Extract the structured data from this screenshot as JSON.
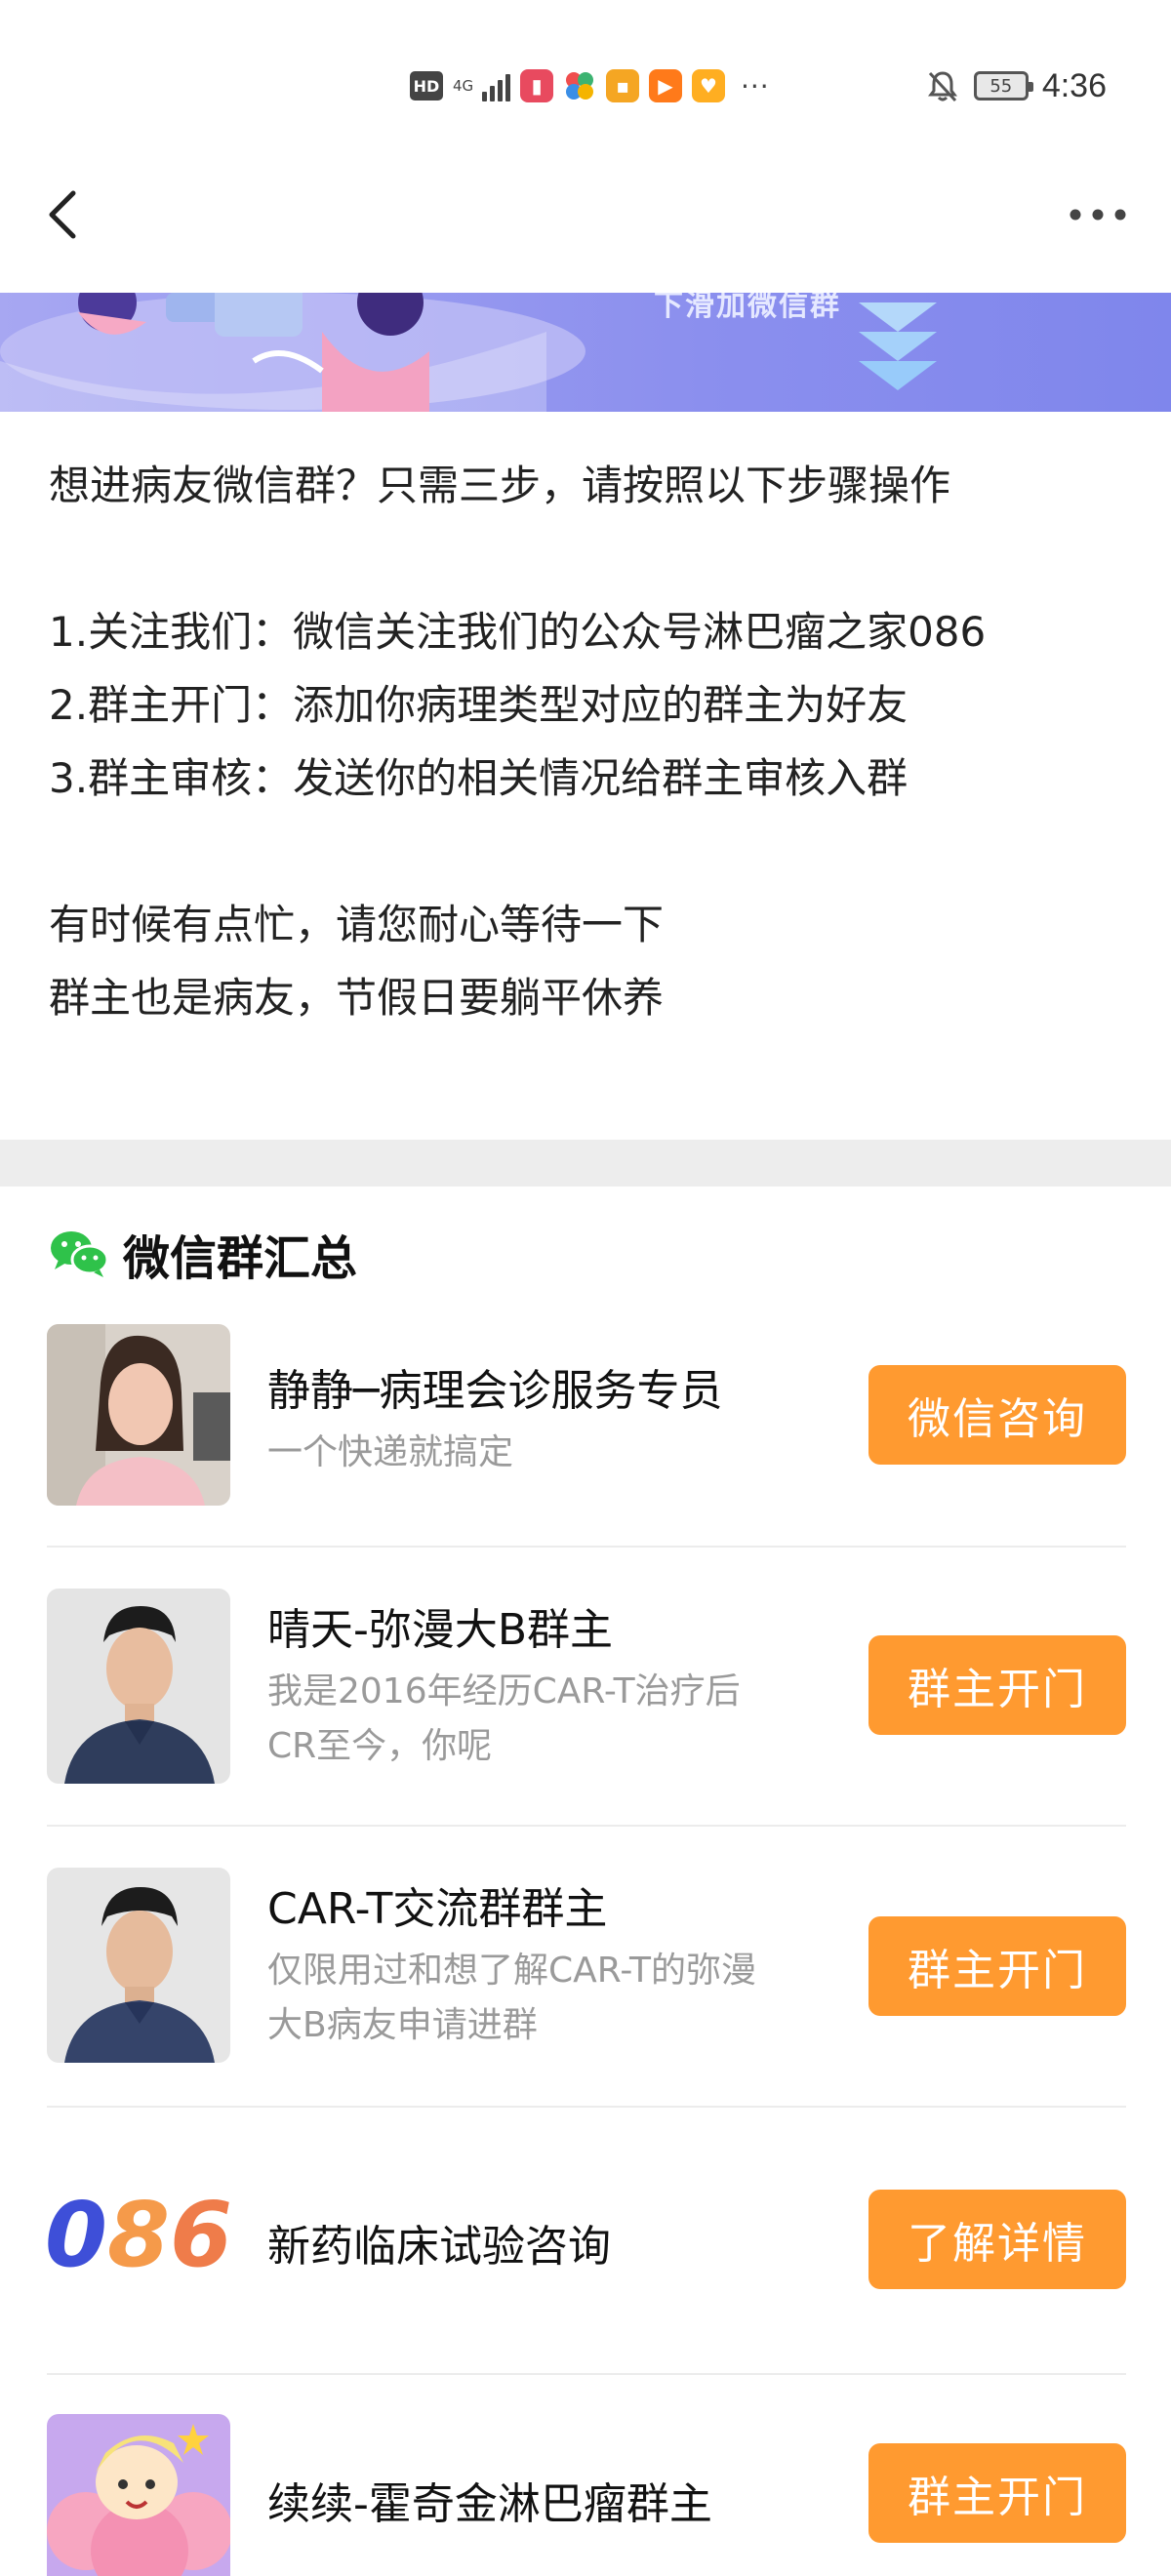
{
  "status_bar": {
    "hd": "HD",
    "network": "4G",
    "battery": "55",
    "time": "4:36",
    "overflow": "···"
  },
  "nav": {
    "back_icon": "back-chevron-icon",
    "more_icon": "more-dots-icon"
  },
  "banner": {
    "text": "下滑加微信群"
  },
  "intro": {
    "headline": "想进病友微信群？只需三步，请按照以下步骤操作",
    "steps": [
      "1.关注我们：微信关注我们的公众号淋巴瘤之家086",
      "2.群主开门：添加你病理类型对应的群主为好友",
      "3.群主审核：发送你的相关情况给群主审核入群"
    ],
    "notes": [
      "有时候有点忙，请您耐心等待一下",
      "群主也是病友，节假日要躺平休养"
    ]
  },
  "groups": {
    "title": "微信群汇总",
    "items": [
      {
        "name": "静静─病理会诊服务专员",
        "desc": [
          "一个快递就搞定"
        ],
        "button": "微信咨询"
      },
      {
        "name": "晴天-弥漫大B群主",
        "desc": [
          "我是2016年经历CAR-T治疗后",
          "CR至今，你呢"
        ],
        "button": "群主开门"
      },
      {
        "name": "CAR-T交流群群主",
        "desc": [
          "仅限用过和想了解CAR-T的弥漫",
          "大B病友申请进群"
        ],
        "button": "群主开门"
      },
      {
        "name": "新药临床试验咨询",
        "desc": [],
        "logo_text": "086",
        "button": "了解详情"
      },
      {
        "name": "续续-霍奇金淋巴瘤群主",
        "desc": [],
        "button": "群主开门"
      }
    ]
  },
  "colors": {
    "accent": "#ff9a30",
    "banner": "#8b8fee",
    "wechat_green": "#2fc24a"
  }
}
